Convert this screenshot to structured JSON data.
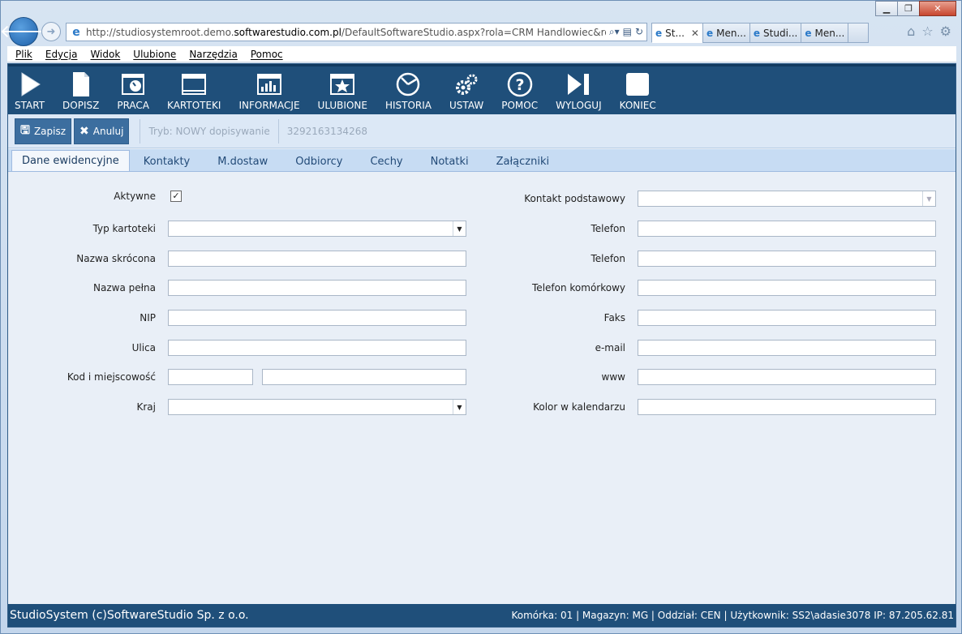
{
  "browser": {
    "url_prefix": "http://studiosystemroot.demo.",
    "url_domain": "softwarestudio.com.pl",
    "url_suffix": "/DefaultSoftwareStudio.aspx?rola=CRM Handlowiec&rolasys=CF",
    "tabs": [
      {
        "label": "St...",
        "active": true
      },
      {
        "label": "Men...",
        "active": false
      },
      {
        "label": "Studi...",
        "active": false
      },
      {
        "label": "Men...",
        "active": false
      }
    ],
    "menu": [
      "Plik",
      "Edycja",
      "Widok",
      "Ulubione",
      "Narzędzia",
      "Pomoc"
    ]
  },
  "toolbar": {
    "items": [
      {
        "label": "START",
        "icon": "play-icon"
      },
      {
        "label": "DOPISZ",
        "icon": "document-icon"
      },
      {
        "label": "PRACA",
        "icon": "clock-window-icon"
      },
      {
        "label": "KARTOTEKI",
        "icon": "window-icon"
      },
      {
        "label": "INFORMACJE",
        "icon": "bar-chart-icon"
      },
      {
        "label": "ULUBIONE",
        "icon": "star-window-icon"
      },
      {
        "label": "HISTORIA",
        "icon": "history-icon"
      },
      {
        "label": "USTAW",
        "icon": "gears-icon"
      },
      {
        "label": "POMOC",
        "icon": "help-icon"
      },
      {
        "label": "WYLOGUJ",
        "icon": "logout-icon"
      },
      {
        "label": "KONIEC",
        "icon": "stop-icon"
      }
    ]
  },
  "actions": {
    "save_label": "Zapisz",
    "cancel_label": "Anuluj",
    "mode_text": "Tryb: NOWY dopisywanie",
    "record_id": "3292163134268"
  },
  "form_tabs": [
    "Dane ewidencyjne",
    "Kontakty",
    "M.dostaw",
    "Odbiorcy",
    "Cechy",
    "Notatki",
    "Załączniki"
  ],
  "left_fields": {
    "aktywne": "Aktywne",
    "typ": "Typ kartoteki",
    "nazwa_skrocona": "Nazwa skrócona",
    "nazwa_pelna": "Nazwa pełna",
    "nip": "NIP",
    "ulica": "Ulica",
    "kod": "Kod i miejscowość",
    "kraj": "Kraj"
  },
  "right_fields": {
    "kontakt": "Kontakt podstawowy",
    "telefon1": "Telefon",
    "telefon2": "Telefon",
    "komorkowy": "Telefon komórkowy",
    "faks": "Faks",
    "email": "e-mail",
    "www": "www",
    "kolor": "Kolor w kalendarzu"
  },
  "aktywne_checked": "✓",
  "status": {
    "left": "StudioSystem (c)SoftwareStudio Sp. z o.o.",
    "right": "Komórka: 01 | Magazyn: MG | Oddział: CEN | Użytkownik: SS2\\adasie3078 IP: 87.205.62.81"
  }
}
